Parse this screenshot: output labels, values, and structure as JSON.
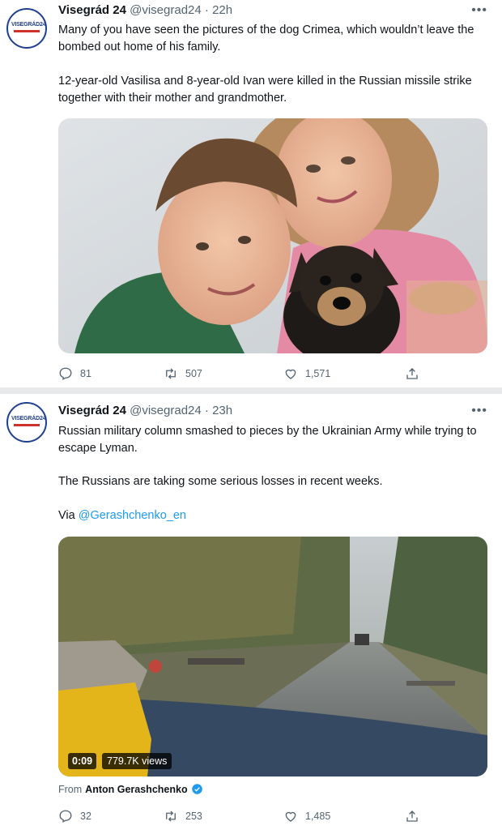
{
  "tweet1": {
    "author": "Visegrád 24",
    "handle": "@visegrad24",
    "dot": "·",
    "time": "22h",
    "avatar_text": "VISEGRÁD24",
    "more": "•••",
    "paragraphs": [
      "Many of you have seen the pictures of the dog Crimea, which wouldn’t leave the bombed out home of his family.",
      "12-year-old Vasilisa and 8-year-old Ivan were killed in the Russian missile strike together with their mother and grandmother."
    ],
    "replies": "81",
    "retweets": "507",
    "likes": "1,571"
  },
  "tweet2": {
    "author": "Visegrád 24",
    "handle": "@visegrad24",
    "dot": "·",
    "time": "23h",
    "avatar_text": "VISEGRÁD24",
    "more": "•••",
    "paragraphs": [
      "Russian military column smashed to pieces by the Ukrainian Army while trying to escape Lyman.",
      "The Russians are taking some serious losses in recent weeks."
    ],
    "via_prefix": "Via ",
    "via_link": "@Gerashchenko_en",
    "video_time": "0:09",
    "video_views": "779.7K views",
    "from_prefix": "From",
    "from_name": "Anton Gerashchenko",
    "replies": "32",
    "retweets": "253",
    "likes": "1,485"
  },
  "colors": {
    "link": "#1d9bf0",
    "muted": "#536471",
    "brand_blue": "#1f3f8f",
    "brand_red": "#d0312d"
  },
  "icons": [
    "reply-icon",
    "retweet-icon",
    "like-icon",
    "share-icon",
    "verified-icon",
    "more-icon"
  ]
}
